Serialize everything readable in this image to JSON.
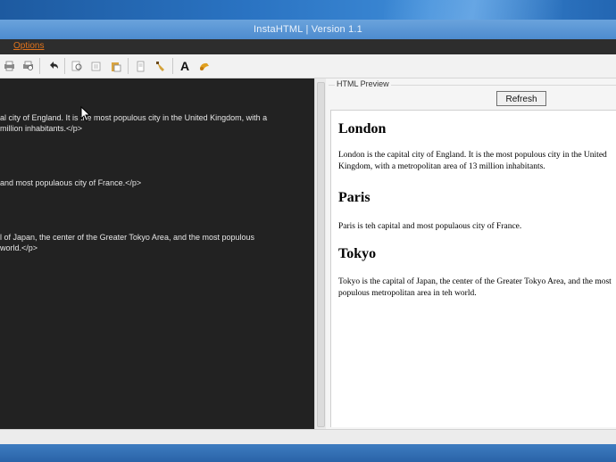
{
  "window": {
    "title": "InstaHTML | Version 1.1"
  },
  "menu": {
    "options_label": "Options"
  },
  "toolbar": {
    "icons": [
      "print-icon",
      "print-preview-icon",
      "undo-icon",
      "find-icon",
      "replace-icon",
      "paste-icon",
      "document-icon",
      "clear-icon",
      "font-icon",
      "color-icon"
    ]
  },
  "editor": {
    "lines": [
      "al city of England. It is the most populous city in the United Kingdom, with a",
      " million inhabitants.</p>",
      "and most populaous city of France.</p>",
      "l of Japan, the center of the Greater Tokyo Area, and the most populous",
      " world.</p>"
    ]
  },
  "preview_panel": {
    "group_label": "HTML Preview",
    "refresh_label": "Refresh"
  },
  "preview": {
    "sections": [
      {
        "heading": "London",
        "text_line1": "London is the capital city of England. It is the most populous city in the United",
        "text_line2": "Kingdom, with a metropolitan area of 13 million inhabitants."
      },
      {
        "heading": "Paris",
        "text_line1": "Paris is teh capital and most populaous city of France.",
        "text_line2": ""
      },
      {
        "heading": "Tokyo",
        "text_line1": "Tokyo is the capital of Japan, the center of the Greater Tokyo Area, and the most",
        "text_line2": "populous metropolitan area in teh world."
      }
    ]
  },
  "colors": {
    "editor_bg": "#222222",
    "menu_accent": "#e0731c",
    "titlebar": "#5a96d6"
  }
}
